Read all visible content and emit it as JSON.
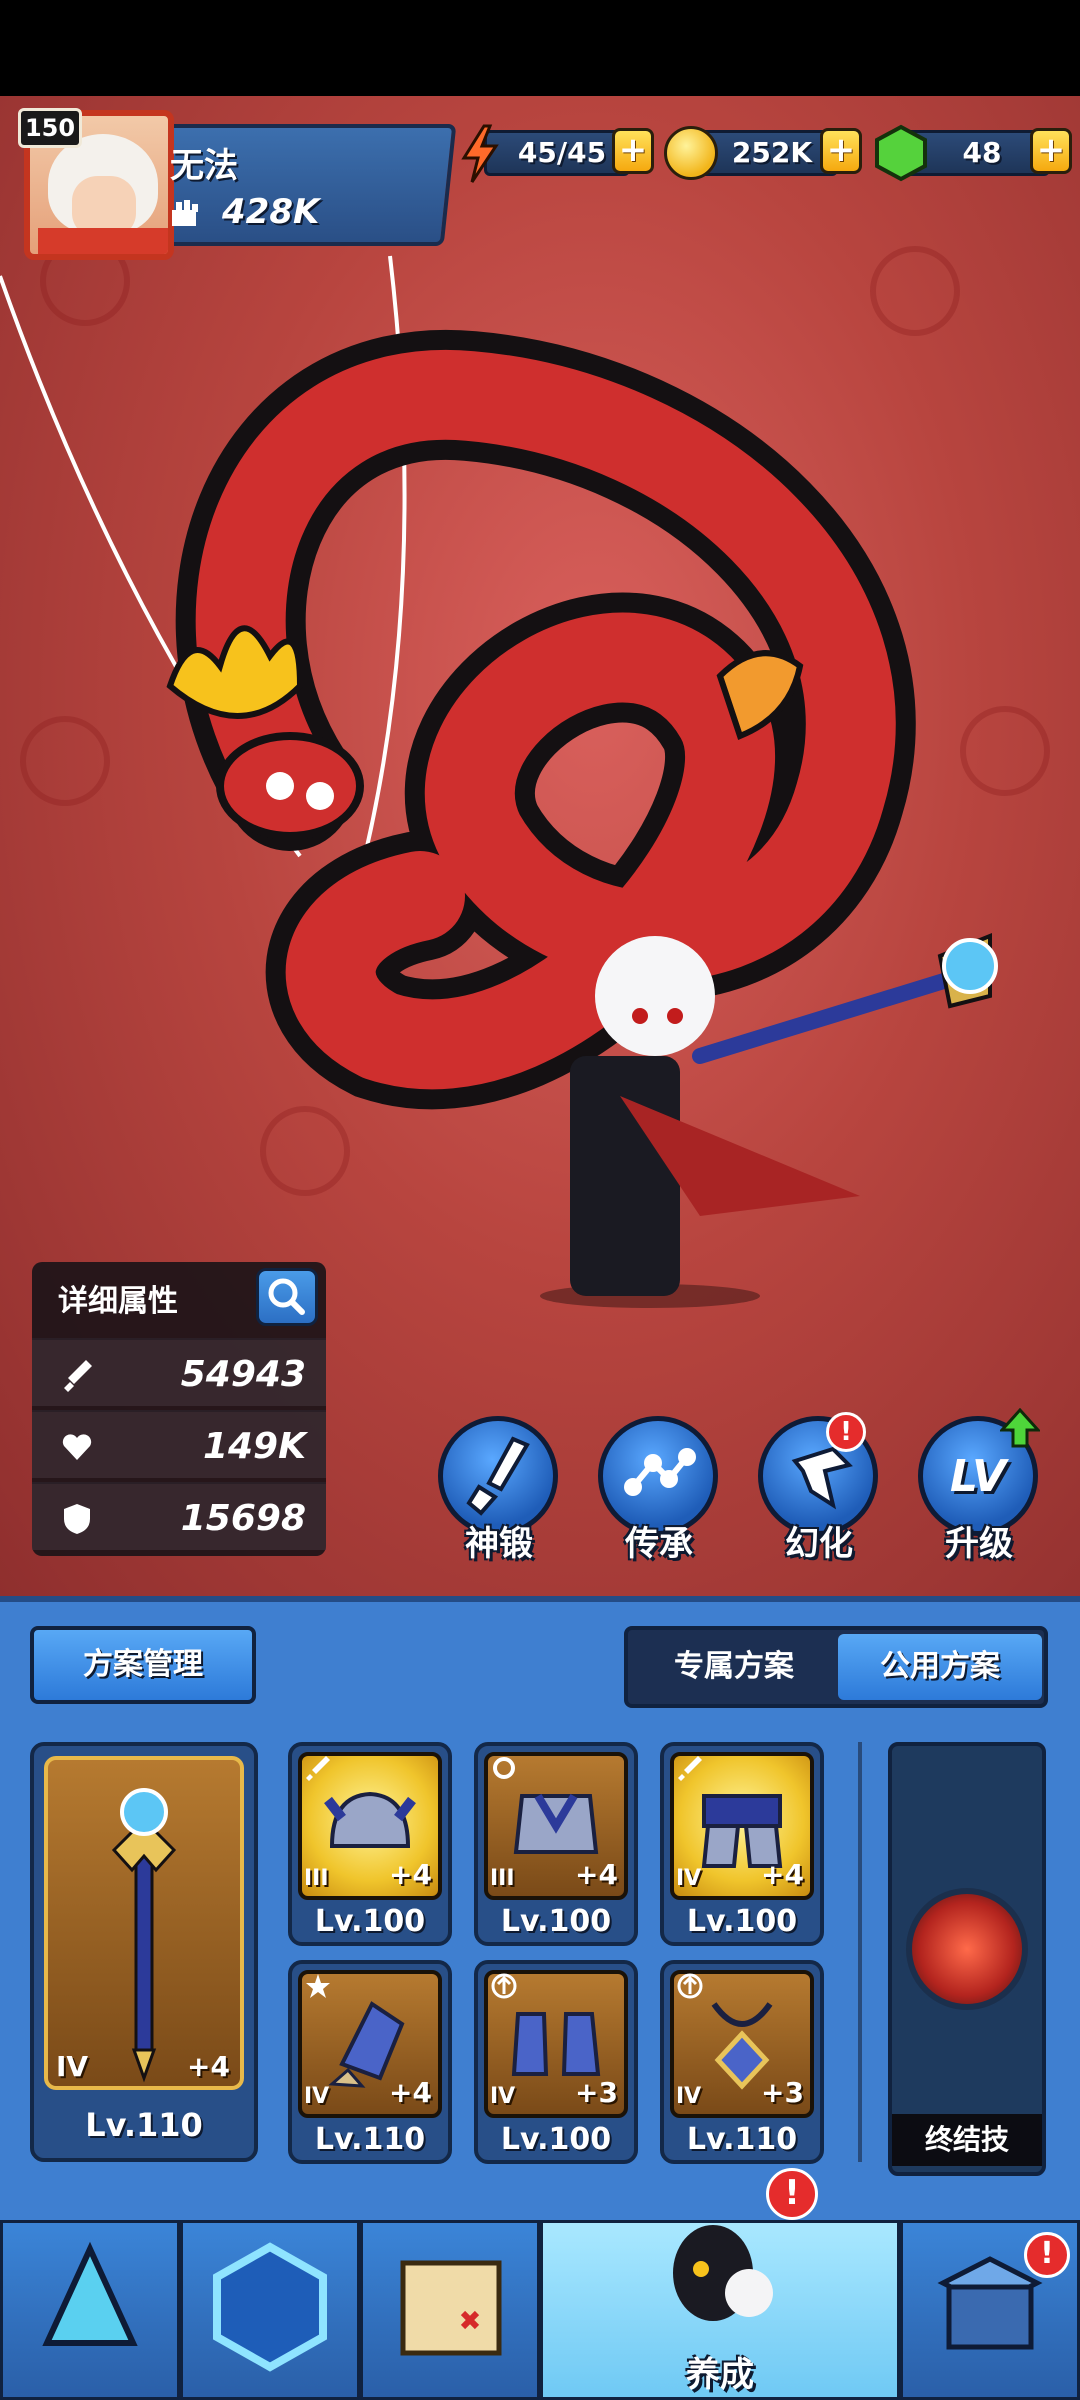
{
  "player": {
    "level": "150",
    "name": "无法",
    "power": "428K"
  },
  "resources": {
    "energy": {
      "value": "45/45",
      "icon": "lightning-icon"
    },
    "gold": {
      "value": "252K",
      "icon": "gold-coin-icon"
    },
    "gems": {
      "value": "48",
      "icon": "green-gem-icon"
    },
    "plus": "+"
  },
  "stats": {
    "title": "详细属性",
    "attack": "54943",
    "hp": "149K",
    "defense": "15698"
  },
  "actions": [
    {
      "label": "神锻",
      "icon": "sword-forge-icon"
    },
    {
      "label": "传承",
      "icon": "inheritance-nodes-icon"
    },
    {
      "label": "幻化",
      "icon": "dragon-transform-icon",
      "badge": "!"
    },
    {
      "label": "升级",
      "icon": "level-up-icon",
      "glyph": "LV"
    }
  ],
  "plan": {
    "manage": "方案管理",
    "exclusive": "专属方案",
    "public": "公用方案"
  },
  "weapon": {
    "tier": "IV",
    "plus": "+4",
    "level": "Lv.110"
  },
  "gear": [
    {
      "tier": "III",
      "plus": "+4",
      "level": "Lv.100",
      "frame": "gold",
      "icon": "helmet-icon"
    },
    {
      "tier": "III",
      "plus": "+4",
      "level": "Lv.100",
      "frame": "bronze",
      "icon": "armor-icon"
    },
    {
      "tier": "IV",
      "plus": "+4",
      "level": "Lv.100",
      "frame": "gold",
      "icon": "belt-icon"
    },
    {
      "tier": "IV",
      "plus": "+4",
      "level": "Lv.110",
      "frame": "bronze",
      "icon": "gloves-icon"
    },
    {
      "tier": "IV",
      "plus": "+3",
      "level": "Lv.100",
      "frame": "bronze",
      "icon": "boots-icon"
    },
    {
      "tier": "IV",
      "plus": "+3",
      "level": "Lv.110",
      "frame": "bronze",
      "icon": "amulet-icon"
    }
  ],
  "ultimate": {
    "label": "终结技"
  },
  "nav": [
    {
      "icon": "battle-icon"
    },
    {
      "icon": "rune-icon"
    },
    {
      "icon": "map-icon"
    },
    {
      "label": "养成",
      "icon": "character-icon",
      "badge": "!"
    },
    {
      "icon": "shop-icon",
      "badge": "!"
    }
  ],
  "colors": {
    "accent": "#3f7fd0",
    "scene": "#b8453f",
    "gold": "#f0c52c",
    "alert": "#e52c2c"
  }
}
